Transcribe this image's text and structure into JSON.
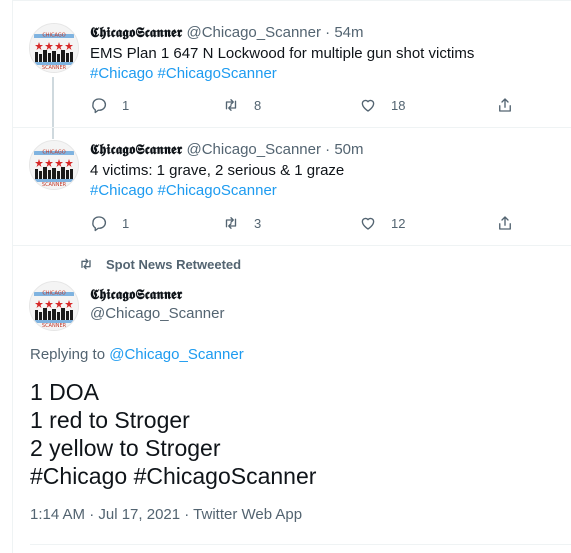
{
  "tweets": [
    {
      "display_name": "𝕮𝖍𝖎𝖈𝖆𝖌𝖔𝕾𝖈𝖆𝖓𝖓𝖊𝖗",
      "handle": "@Chicago_Scanner",
      "sep": "·",
      "time": "54m",
      "text": "EMS Plan 1 647 N Lockwood for multiple gun shot victims",
      "hashtags": "#Chicago #ChicagoScanner",
      "replies": "1",
      "retweets": "8",
      "likes": "18"
    },
    {
      "display_name": "𝕮𝖍𝖎𝖈𝖆𝖌𝖔𝕾𝖈𝖆𝖓𝖓𝖊𝖗",
      "handle": "@Chicago_Scanner",
      "sep": "·",
      "time": "50m",
      "text": "4 victims: 1 grave, 2 serious & 1 graze",
      "hashtags": "#Chicago #ChicagoScanner",
      "replies": "1",
      "retweets": "3",
      "likes": "12"
    }
  ],
  "main": {
    "retweeted_by": "Spot News Retweeted",
    "display_name": "𝕮𝖍𝖎𝖈𝖆𝖌𝖔𝕾𝖈𝖆𝖓𝖓𝖊𝖗",
    "handle": "@Chicago_Scanner",
    "replying_prefix": "Replying to ",
    "replying_to": "@Chicago_Scanner",
    "lines": [
      "1 DOA",
      "1 red to Stroger",
      "2 yellow to Stroger"
    ],
    "hashtags": "#Chicago #ChicagoScanner",
    "timestamp": "1:14 AM · Jul 17, 2021 · Twitter Web App"
  },
  "colors": {
    "link": "#1d9bf0",
    "muted": "#536471",
    "thread": "#cfd9de"
  }
}
